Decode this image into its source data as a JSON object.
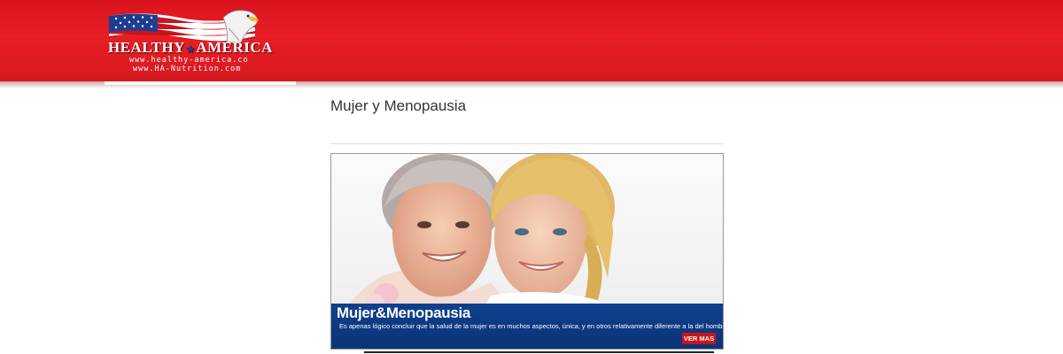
{
  "header": {
    "brand_left": "HEALTHY",
    "brand_right": "AMERICA",
    "url_primary": "www.healthy-america.co",
    "url_secondary": "www.HA-Nutrition.com",
    "background_color": "#e31b23"
  },
  "main": {
    "title": "Mujer y Menopausia",
    "banner": {
      "title": "Mujer&Menopausia",
      "description": "Es apenas lógico concluir que la salud de la mujer es en muchos aspectos, única, y en otros relativamente diferente a la del hombre.",
      "button_label": "VER MAS",
      "bar_color": "#0f3f8e",
      "button_color": "#c8141c"
    }
  }
}
